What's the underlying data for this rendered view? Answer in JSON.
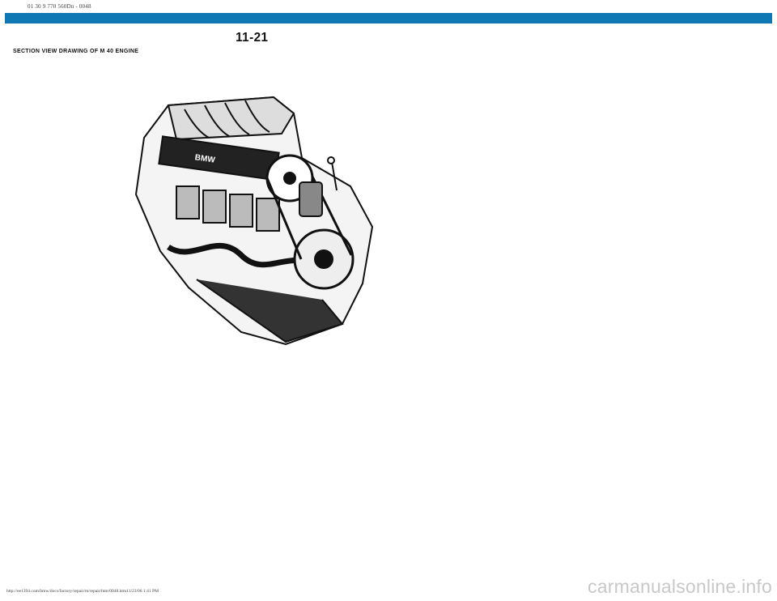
{
  "browser": {
    "title": "01 30 9 770 560Dn - 0048"
  },
  "page": {
    "number": "11-21",
    "section_title": "SECTION VIEW DRAWING OF M 40 ENGINE",
    "figure_name": "engine-section-drawing"
  },
  "footer": {
    "url": "http://ee1394.com/bmw/docs/factory/repair/m/repair/htm/0048.htm11/23/06 1:41 PM"
  },
  "watermark": "carmanualsonline.info",
  "colors": {
    "top_bar": "#0f78b4",
    "watermark": "#c8c8c8"
  }
}
